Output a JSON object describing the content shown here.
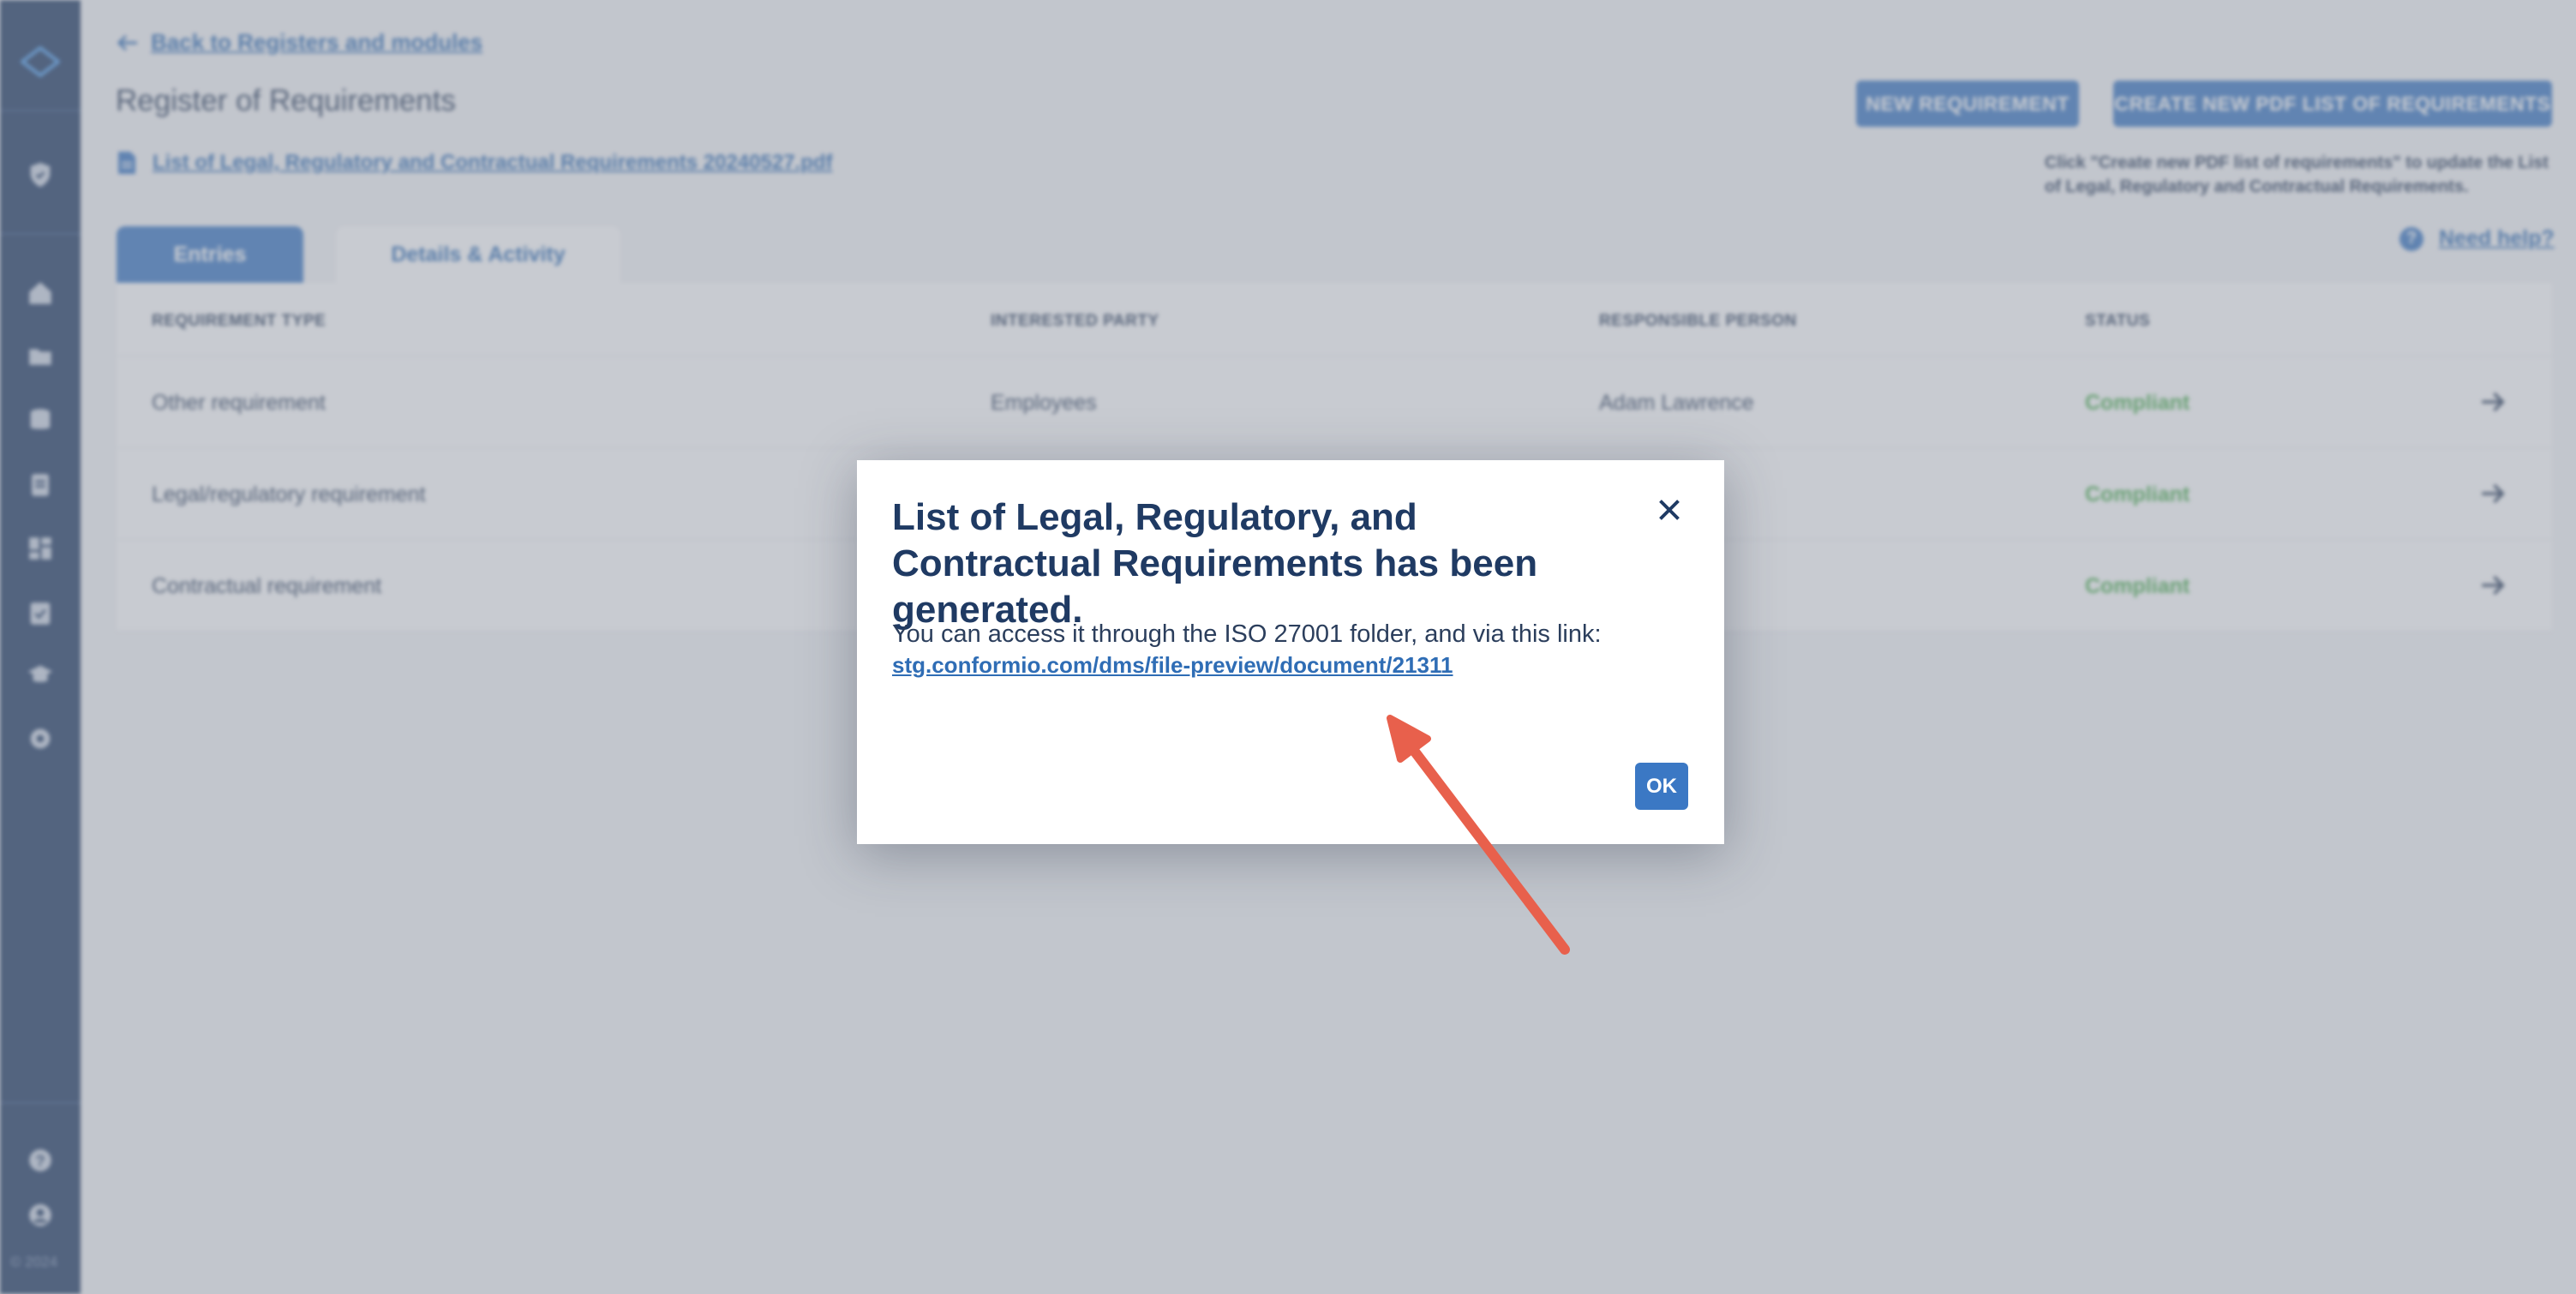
{
  "sidebar": {
    "icons": [
      "logo-icon",
      "shield-icon",
      "home-icon",
      "folder-icon",
      "database-icon",
      "document-icon",
      "dashboard-icon",
      "checklist-icon",
      "training-icon",
      "settings-icon",
      "help-icon",
      "user-icon"
    ],
    "copyright": "© 2024"
  },
  "header": {
    "back_link": "Back to Registers and modules",
    "title": "Register of Requirements",
    "pdf_link": "List of Legal, Regulatory and Contractual Requirements 20240527.pdf",
    "new_requirement_button": "NEW REQUIREMENT",
    "create_pdf_button": "CREATE NEW PDF LIST OF REQUIREMENTS",
    "hint": "Click \"Create new PDF list of requirements\" to update the List of Legal, Regulatory and Contractual Requirements.",
    "help_link": "Need help?"
  },
  "tabs": [
    {
      "label": "Entries"
    },
    {
      "label": "Details & Activity"
    }
  ],
  "table": {
    "columns": [
      "REQUIREMENT TYPE",
      "INTERESTED PARTY",
      "RESPONSIBLE PERSON",
      "STATUS"
    ],
    "rows": [
      {
        "type": "Other requirement",
        "party": "Employees",
        "person": "Adam Lawrence",
        "status": "Compliant"
      },
      {
        "type": "Legal/regulatory requirement",
        "party": "",
        "person": "",
        "status": "Compliant"
      },
      {
        "type": "Contractual requirement",
        "party": "",
        "person": "",
        "status": "Compliant"
      }
    ]
  },
  "modal": {
    "title": "List of Legal, Regulatory, and Contractual Requirements has been generated.",
    "body": "You can access it through the ISO 27001 folder, and via this link:",
    "link": "stg.conformio.com/dms/file-preview/document/21311",
    "ok_button": "OK"
  },
  "colors": {
    "sidebar": "#1f3a63",
    "accent": "#3b78c4",
    "status_ok": "#4caf50",
    "annotation_arrow": "#e8604c"
  }
}
